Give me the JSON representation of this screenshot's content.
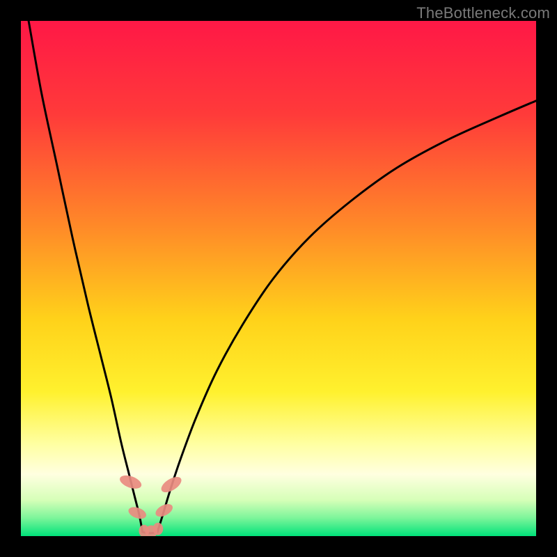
{
  "watermark": "TheBottleneck.com",
  "chart_data": {
    "type": "line",
    "title": "",
    "xlabel": "",
    "ylabel": "",
    "xlim": [
      0,
      100
    ],
    "ylim": [
      0,
      100
    ],
    "gradient_stops": [
      {
        "offset": 0.0,
        "color": "#ff1846"
      },
      {
        "offset": 0.18,
        "color": "#ff3a3a"
      },
      {
        "offset": 0.4,
        "color": "#ff8a28"
      },
      {
        "offset": 0.58,
        "color": "#ffd21a"
      },
      {
        "offset": 0.72,
        "color": "#fff12e"
      },
      {
        "offset": 0.82,
        "color": "#ffffa0"
      },
      {
        "offset": 0.88,
        "color": "#ffffe0"
      },
      {
        "offset": 0.93,
        "color": "#d6ffb8"
      },
      {
        "offset": 0.965,
        "color": "#7cf59a"
      },
      {
        "offset": 1.0,
        "color": "#00e27a"
      }
    ],
    "series": [
      {
        "name": "left-branch",
        "x": [
          1.5,
          4.0,
          7.0,
          10.0,
          13.0,
          15.5,
          17.5,
          19.5,
          21.0,
          22.0,
          23.0,
          23.6
        ],
        "values": [
          100,
          86,
          72,
          58,
          45,
          35,
          27,
          18,
          12,
          8,
          4,
          0.8
        ]
      },
      {
        "name": "right-branch",
        "x": [
          26.5,
          27.5,
          29.0,
          31.0,
          34.0,
          38.0,
          43.0,
          49.0,
          56.0,
          64.0,
          73.0,
          83.0,
          93.0,
          100.0
        ],
        "values": [
          0.8,
          4,
          9,
          15,
          23,
          32,
          41,
          50,
          58,
          65,
          71.5,
          77,
          81.5,
          84.5
        ]
      },
      {
        "name": "valley-floor",
        "x": [
          23.6,
          24.5,
          25.5,
          26.5
        ],
        "values": [
          0.8,
          0.6,
          0.6,
          0.8
        ]
      }
    ],
    "markers": [
      {
        "name": "left-upper",
        "cx": 21.3,
        "cy": 10.5,
        "rx": 1.1,
        "ry": 2.2,
        "rotate": -70
      },
      {
        "name": "left-lower",
        "cx": 22.6,
        "cy": 4.5,
        "rx": 1.0,
        "ry": 1.8,
        "rotate": -70
      },
      {
        "name": "floor-1",
        "cx": 23.9,
        "cy": 1.0,
        "rx": 1.0,
        "ry": 1.2,
        "rotate": 0
      },
      {
        "name": "floor-2",
        "cx": 25.3,
        "cy": 0.9,
        "rx": 1.2,
        "ry": 1.2,
        "rotate": 0
      },
      {
        "name": "floor-3",
        "cx": 26.6,
        "cy": 1.4,
        "rx": 1.0,
        "ry": 1.2,
        "rotate": 0
      },
      {
        "name": "right-lower",
        "cx": 27.8,
        "cy": 5.0,
        "rx": 1.0,
        "ry": 1.8,
        "rotate": 62
      },
      {
        "name": "right-upper",
        "cx": 29.2,
        "cy": 10.0,
        "rx": 1.1,
        "ry": 2.2,
        "rotate": 58
      }
    ],
    "marker_color": "#e98b80"
  }
}
